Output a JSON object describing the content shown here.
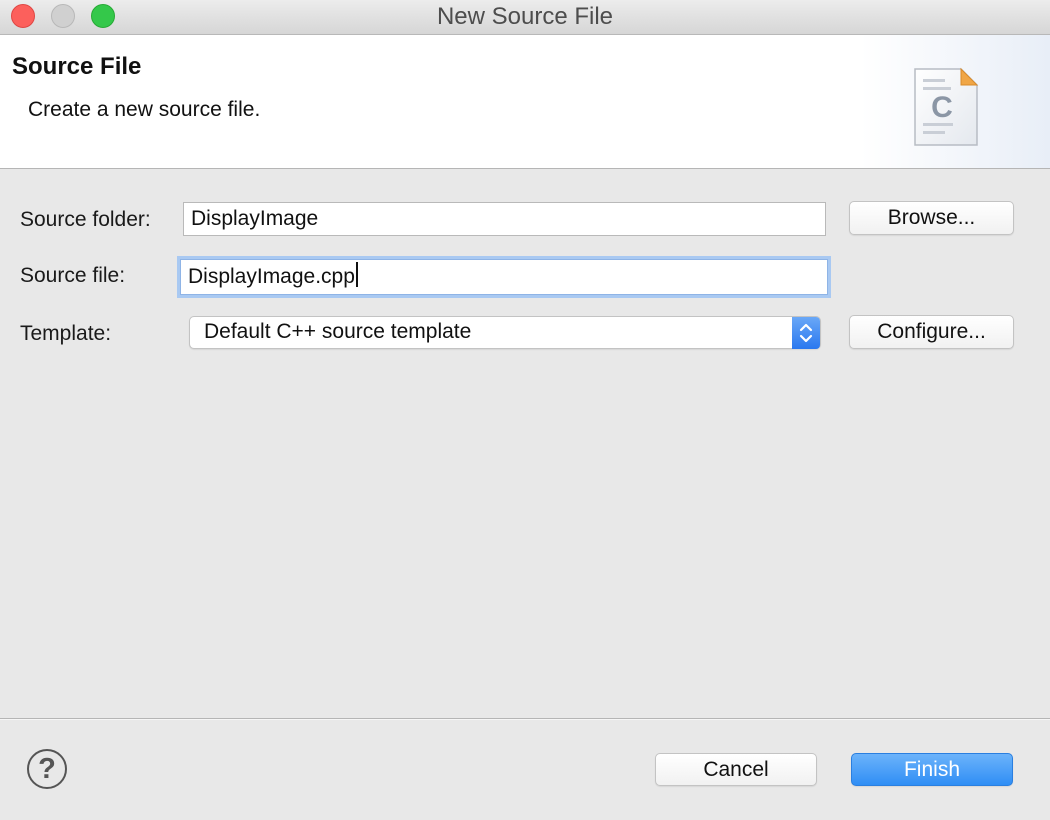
{
  "window": {
    "title": "New Source File"
  },
  "header": {
    "title": "Source File",
    "description": "Create a new source file.",
    "icon": "c-source-file-icon",
    "icon_letter": "C"
  },
  "form": {
    "source_folder": {
      "label": "Source folder:",
      "value": "DisplayImage",
      "browse_label": "Browse..."
    },
    "source_file": {
      "label": "Source file:",
      "value": "DisplayImage.cpp"
    },
    "template": {
      "label": "Template:",
      "selected": "Default C++ source template",
      "configure_label": "Configure..."
    }
  },
  "footer": {
    "help_symbol": "?",
    "cancel_label": "Cancel",
    "finish_label": "Finish"
  },
  "colors": {
    "accent": "#2f8ef5",
    "close": "#fc605c",
    "maximize": "#34c84a"
  }
}
